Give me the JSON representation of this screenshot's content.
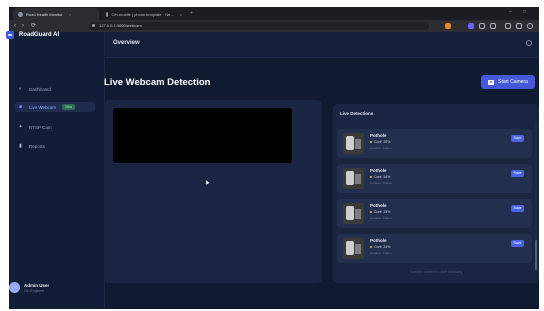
{
  "browser": {
    "tabs": [
      {
        "label": "Road Health Monitor"
      },
      {
        "label": "Cfn-mobile | phone template · Ne..."
      }
    ],
    "new_tab": "+",
    "window_controls": {
      "minimize": "–",
      "maximize": "□"
    },
    "nav": {
      "back": "‹",
      "forward": "›",
      "reload": "⟳"
    },
    "url": "127.0.0.1:5000/webcam"
  },
  "sidebar": {
    "brand": "RoadGuard AI",
    "items": [
      {
        "label": "Dashboard",
        "icon": "gauge-icon"
      },
      {
        "label": "Live Webcam",
        "icon": "webcam-icon",
        "badge": "New"
      },
      {
        "label": "RTSP Cam",
        "icon": "rtsp-icon"
      },
      {
        "label": "Reports",
        "icon": "report-icon"
      }
    ],
    "user": {
      "name": "Admin User",
      "role": "Cfn Engineer"
    }
  },
  "header": {
    "title": "Overview"
  },
  "main": {
    "title": "Live Webcam Detection",
    "start_button": "Start Camera",
    "detections": {
      "title": "Live Detections",
      "items": [
        {
          "label": "Pothole",
          "confidence": "Conf: 20%",
          "location": "Location: Frame",
          "action": "Save"
        },
        {
          "label": "Pothole",
          "confidence": "Conf: 24%",
          "location": "Location: Frame",
          "action": "Save"
        },
        {
          "label": "Pothole",
          "confidence": "Conf: 23%",
          "location": "Location: Frame",
          "action": "Save"
        },
        {
          "label": "Pothole",
          "confidence": "Conf: 24%",
          "location": "Location: Frame",
          "action": "Save"
        }
      ],
      "hint": "Connect camera to start detecting"
    }
  },
  "colors": {
    "background": "#101a30",
    "sidebar": "#121d37",
    "panel": "#1a2641",
    "accent": "#4559d8",
    "active_nav": "#8fa3ff"
  }
}
